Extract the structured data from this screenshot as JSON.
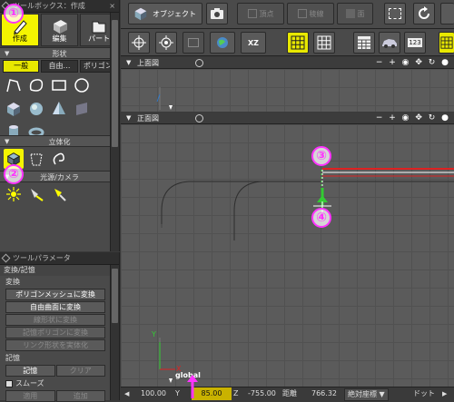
{
  "toolbox": {
    "title": "ツールボックス：作成",
    "modes": [
      {
        "label": "作成",
        "icon": "pen-icon",
        "active": true
      },
      {
        "label": "編集",
        "icon": "edit-box-icon",
        "active": false
      },
      {
        "label": "パート",
        "icon": "part-folder-icon",
        "active": false
      }
    ],
    "shape_section": "形状",
    "subtabs": [
      {
        "label": "一般",
        "active": true
      },
      {
        "label": "自由…",
        "active": false
      },
      {
        "label": "ポリゴン",
        "active": false
      }
    ],
    "solidify_section": "立体化",
    "light_section": "光源/カメラ"
  },
  "params": {
    "title": "ツールパラメータ",
    "sub": "変換/記憶",
    "convert_group": "変換",
    "buttons": [
      {
        "label": "ポリゴンメッシュに変換",
        "enabled": true
      },
      {
        "label": "自由曲面に変換",
        "enabled": true
      },
      {
        "label": "線形状に変換",
        "enabled": false
      },
      {
        "label": "記憶ポリゴンに変換",
        "enabled": false
      },
      {
        "label": "リンク形状を実体化",
        "enabled": false
      }
    ],
    "memory_group": "記憶",
    "memory_buttons": [
      {
        "label": "記憶",
        "enabled": true
      },
      {
        "label": "クリア",
        "enabled": false
      }
    ],
    "smooth_label": "スムーズ",
    "bottom_buttons": [
      {
        "label": "適用",
        "enabled": false
      },
      {
        "label": "追加",
        "enabled": false
      }
    ]
  },
  "toolbar": {
    "object_label": "オブジェクト",
    "vertex_label": "頂点",
    "edge_label": "稜線",
    "face_label": "面",
    "xz_label": "XZ",
    "num_label": "123"
  },
  "viewports": {
    "top_title": "上面図",
    "front_title": "正面図",
    "controls": "− + ◉ ✥ ↻ ●",
    "axis_label": "global"
  },
  "status": {
    "x_value": "100.00",
    "y_label": "Y",
    "y_value": "85.00",
    "z_label": "Z",
    "z_value": "-755.00",
    "distance_label": "距離",
    "distance_value": "766.32",
    "coord_mode": "絶対座標",
    "unit": "ドット"
  },
  "markers": [
    "①",
    "②",
    "③",
    "④"
  ],
  "colors": {
    "highlight": "#f4f400",
    "marker": "#ff33ff",
    "selection_red": "#dd2222",
    "green_axis": "#33cc33"
  }
}
